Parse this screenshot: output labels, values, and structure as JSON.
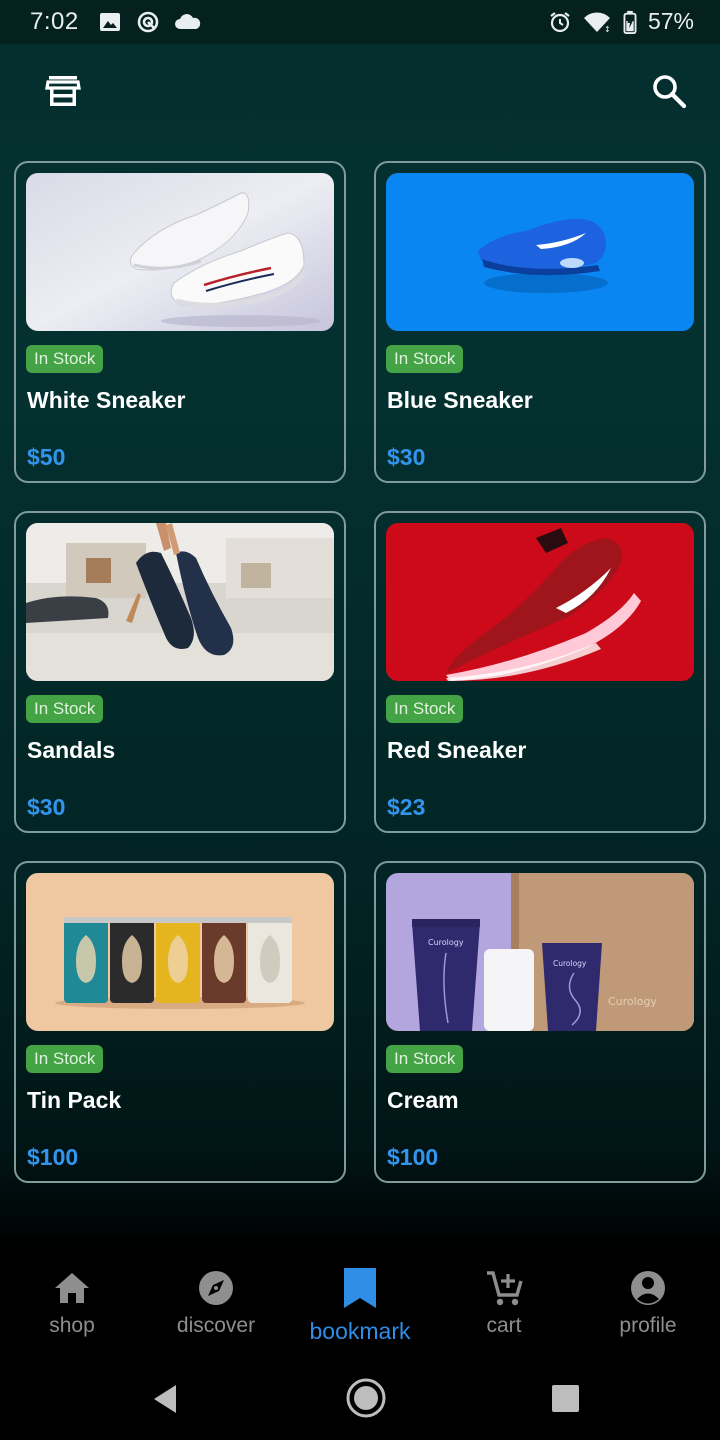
{
  "status_bar": {
    "time": "7:02",
    "battery": "57%",
    "icons": [
      "image-icon",
      "sync-icon",
      "cloud-icon",
      "alarm-icon",
      "wifi-icon",
      "battery-icon"
    ]
  },
  "app_bar": {
    "left_icon": "store-icon",
    "right_icon": "search-icon"
  },
  "products": [
    {
      "name": "White Sneaker",
      "stock": "In Stock",
      "price": "$50",
      "image": "white-sneaker-photo"
    },
    {
      "name": "Blue Sneaker",
      "stock": "In Stock",
      "price": "$30",
      "image": "blue-sneaker-photo"
    },
    {
      "name": "Sandals",
      "stock": "In Stock",
      "price": "$30",
      "image": "sandals-photo"
    },
    {
      "name": "Red Sneaker",
      "stock": "In Stock",
      "price": "$23",
      "image": "red-sneaker-photo"
    },
    {
      "name": "Tin Pack",
      "stock": "In Stock",
      "price": "$100",
      "image": "tin-pack-photo"
    },
    {
      "name": "Cream",
      "stock": "In Stock",
      "price": "$100",
      "image": "cream-photo"
    }
  ],
  "image_text": {
    "curology_1": "Curology",
    "curology_2": "Curology",
    "curology_3": "Curology"
  },
  "bottom_nav": {
    "items": [
      {
        "label": "shop",
        "icon": "home-icon"
      },
      {
        "label": "discover",
        "icon": "compass-icon"
      },
      {
        "label": "bookmark",
        "icon": "bookmark-icon",
        "active": true
      },
      {
        "label": "cart",
        "icon": "add-cart-icon"
      },
      {
        "label": "profile",
        "icon": "account-icon"
      }
    ]
  },
  "colors": {
    "background_top": "#043030",
    "accent": "#3394ee",
    "badge": "#43a345",
    "nav_inactive": "#8e8e8e"
  }
}
